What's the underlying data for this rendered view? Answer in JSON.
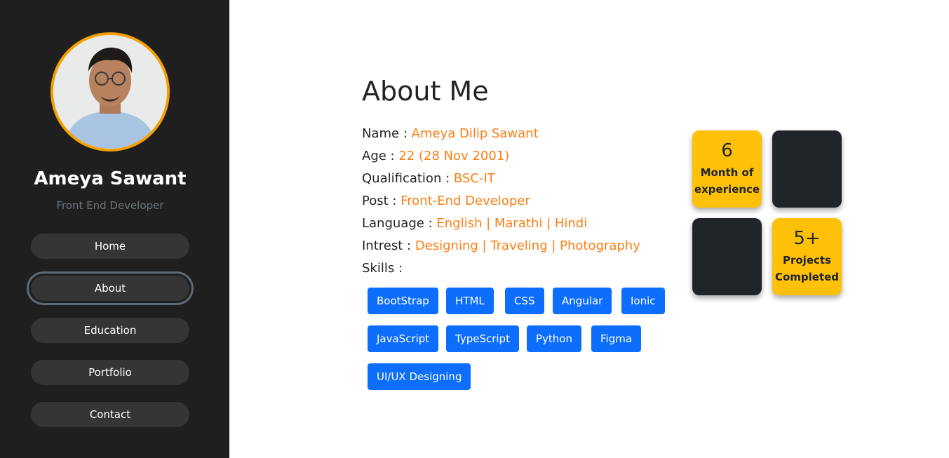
{
  "profile": {
    "name": "Ameya Sawant",
    "role": "Front End Developer"
  },
  "nav": {
    "items": [
      {
        "label": "Home"
      },
      {
        "label": "About"
      },
      {
        "label": "Education"
      },
      {
        "label": "Portfolio"
      },
      {
        "label": "Contact"
      }
    ],
    "active": "About"
  },
  "about": {
    "title": "About Me",
    "rows": [
      {
        "key": "Name :",
        "value": "Ameya Dilip Sawant"
      },
      {
        "key": "Age :",
        "value": "22 (28 Nov 2001)"
      },
      {
        "key": "Qualification :",
        "value": "BSC-IT"
      },
      {
        "key": "Post :",
        "value": "Front-End Developer"
      },
      {
        "key": "Language :",
        "value": "English | Marathi | Hindi"
      },
      {
        "key": "Intrest :",
        "value": "Designing | Traveling | Photography"
      }
    ],
    "skills_label": "Skills :",
    "skills": [
      "BootStrap",
      "HTML",
      "CSS",
      "Angular",
      "Ionic",
      "JavaScript",
      "TypeScript",
      "Python",
      "Figma",
      "UI/UX Designing"
    ]
  },
  "stats": [
    {
      "value": "6",
      "label": "Month of experience"
    },
    {
      "value": "5+",
      "label": "Projects Completed"
    }
  ],
  "colors": {
    "sidebar": "#1f1f1f",
    "accent_orange": "#fd7e14",
    "avatar_ring": "#f5a000",
    "skill_blue": "#0d6efd",
    "tile_yellow": "#ffc107",
    "tile_dark": "#212529"
  }
}
